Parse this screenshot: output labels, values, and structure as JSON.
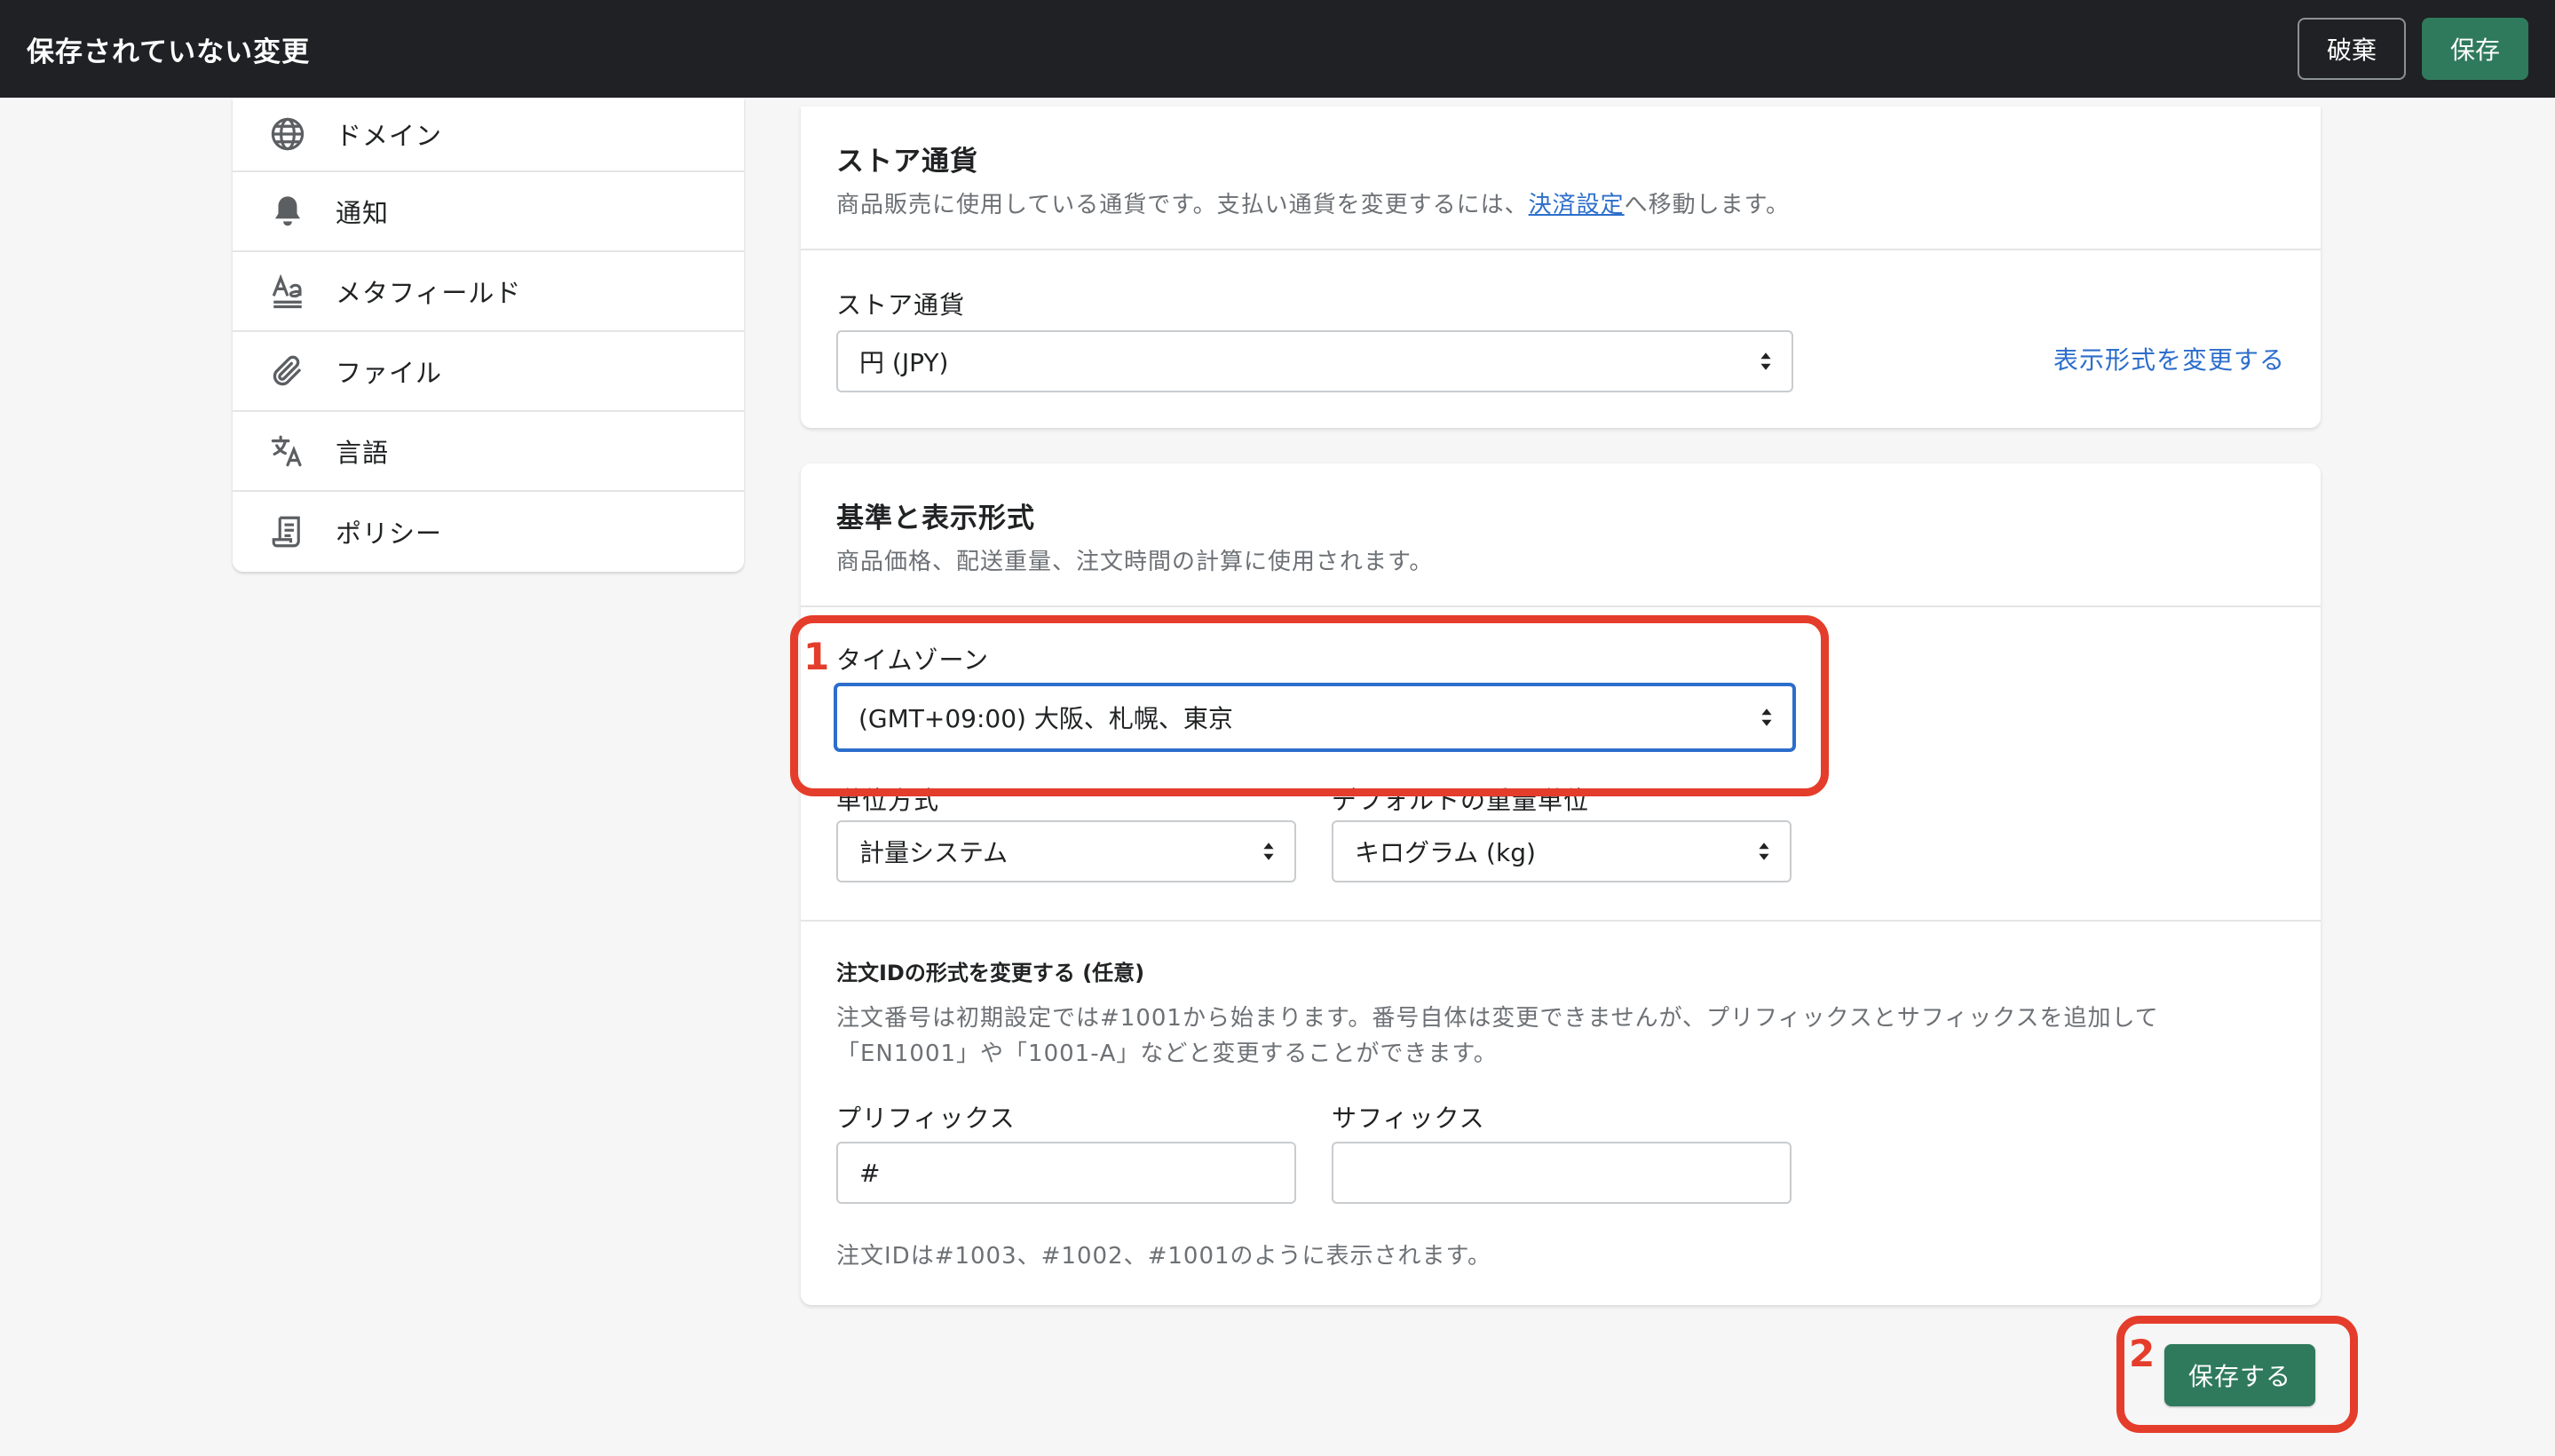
{
  "topbar": {
    "title": "保存されていない変更",
    "discard_label": "破棄",
    "save_label": "保存"
  },
  "sidebar": {
    "items": [
      {
        "label": "ドメイン",
        "icon": "globe-icon"
      },
      {
        "label": "通知",
        "icon": "bell-icon"
      },
      {
        "label": "メタフィールド",
        "icon": "metafield-icon"
      },
      {
        "label": "ファイル",
        "icon": "paperclip-icon"
      },
      {
        "label": "言語",
        "icon": "translate-icon"
      },
      {
        "label": "ポリシー",
        "icon": "policy-icon"
      }
    ]
  },
  "currency_card": {
    "title": "ストア通貨",
    "desc_before": "商品販売に使用している通貨です。支払い通貨を変更するには、",
    "desc_link": "決済設定",
    "desc_after": "へ移動します。",
    "field_label": "ストア通貨",
    "field_value": "円 (JPY)",
    "change_format_link": "表示形式を変更する"
  },
  "standards_card": {
    "title": "基準と表示形式",
    "desc": "商品価格、配送重量、注文時間の計算に使用されます。",
    "timezone_label": "タイムゾーン",
    "timezone_value": "(GMT+09:00) 大阪、札幌、東京",
    "unit_system_label": "単位方式",
    "unit_system_value": "計量システム",
    "weight_unit_label": "デフォルトの重量単位",
    "weight_unit_value": "キログラム (kg)",
    "order_id_title": "注文IDの形式を変更する (任意)",
    "order_id_desc_line1": "注文番号は初期設定では#1001から始まります。番号自体は変更できませんが、プリフィックスとサフィックスを追加して",
    "order_id_desc_line2": "「EN1001」や「1001-A」などと変更することができます。",
    "prefix_label": "プリフィックス",
    "prefix_value": "#",
    "suffix_label": "サフィックス",
    "suffix_value": "",
    "order_id_preview": "注文IDは#1003、#1002、#1001のように表示されます。"
  },
  "annotations": {
    "step1": "1",
    "step2": "2"
  },
  "save_bottom_label": "保存する",
  "colors": {
    "topbar_bg": "#1f2124",
    "primary_green": "#2f7a5c",
    "link_blue": "#2c6ecb",
    "annotation_red": "#e53d2b"
  }
}
